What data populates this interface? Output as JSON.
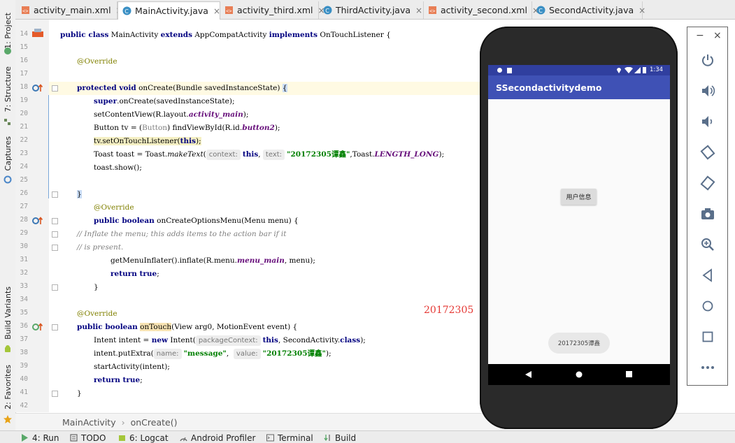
{
  "tabs": [
    {
      "label": "activity_main.xml",
      "close": "×",
      "icon": "xml-file-icon",
      "active": false
    },
    {
      "label": "MainActivity.java",
      "close": "×",
      "icon": "java-class-icon",
      "active": true
    },
    {
      "label": "activity_third.xml",
      "close": "×",
      "icon": "xml-file-icon",
      "active": false
    },
    {
      "label": "ThirdActivity.java",
      "close": "×",
      "icon": "java-class-icon",
      "active": false
    },
    {
      "label": "activity_second.xml",
      "close": "×",
      "icon": "xml-file-icon",
      "active": false
    },
    {
      "label": "SecondActivity.java",
      "close": "×",
      "icon": "java-class-icon",
      "active": false
    }
  ],
  "left_tools": [
    "1: Project",
    "7: Structure",
    "Captures",
    "Build Variants",
    "2: Favorites"
  ],
  "line_numbers": [
    "14",
    "15",
    "16",
    "17",
    "18",
    "19",
    "20",
    "21",
    "22",
    "23",
    "24",
    "25",
    "26",
    "27",
    "28",
    "29",
    "30",
    "31",
    "32",
    "33",
    "34",
    "35",
    "36",
    "37",
    "38",
    "39",
    "40",
    "41",
    "42"
  ],
  "code": {
    "l14": {
      "kw1": "public class",
      "t1": " MainActivity ",
      "kw2": "extends",
      "t2": " AppCompatActivity ",
      "kw3": "implements",
      "t3": " OnTouchListener {"
    },
    "l16": {
      "ann": "@Override"
    },
    "l18": {
      "kw": "protected void",
      "t1": " onCreate(Bundle savedInstanceState) ",
      "brace": "{"
    },
    "l19": {
      "kw": "super",
      "t": ".onCreate(savedInstanceState);"
    },
    "l20": {
      "t1": "setContentView(R.layout.",
      "fld": "activity_main",
      "t2": ");"
    },
    "l21": {
      "t1": "Button tv = (",
      "gray": "Button",
      "t2": ") findViewById(R.id.",
      "fld": "button2",
      "t3": ");"
    },
    "l22": {
      "t1": "tv.setOnTouchListener(",
      "kw": "this",
      "t2": ");"
    },
    "l23": {
      "t1": "Toast toast = Toast.",
      "it": "makeText",
      "t2": "(",
      "hint1": "context:",
      "kw": "this",
      "t3": ", ",
      "hint2": "text:",
      "str": "\"20172305谭鑫\"",
      "t4": ",Toast.",
      "fld": "LENGTH_LONG",
      "t5": ");"
    },
    "l24": {
      "t": "toast.show();"
    },
    "l26": {
      "t": "}"
    },
    "l27": {
      "ann": "@Override"
    },
    "l28": {
      "kw": "public boolean",
      "t": " onCreateOptionsMenu(Menu menu) {"
    },
    "l29": {
      "cmt": "// Inflate the menu; this adds items to the action bar if it"
    },
    "l30": {
      "cmt": "// is present."
    },
    "l31": {
      "t1": "getMenuInflater().inflate(R.menu.",
      "fld": "menu_main",
      "t2": ", menu);"
    },
    "l32": {
      "kw": "return true",
      "t": ";"
    },
    "l33": {
      "t": "}"
    },
    "l35": {
      "ann": "@Override"
    },
    "l36": {
      "kw": "public boolean",
      "t1": " ",
      "hl": "onTouch",
      "t2": "(View arg0, MotionEvent event) {"
    },
    "l37": {
      "t1": "Intent intent = ",
      "kw1": "new",
      "t2": " Intent(",
      "hint": "packageContext:",
      "kw2": "this",
      "t3": ", SecondActivity.",
      "kw3": "class",
      "t4": ");"
    },
    "l38": {
      "t1": "intent.putExtra(",
      "hint1": "name:",
      "str1": "\"message\"",
      "t2": ",  ",
      "hint2": "value:",
      "str2": "\"20172305谭鑫\"",
      "t3": ");"
    },
    "l39": {
      "t": "startActivity(intent);"
    },
    "l40": {
      "kw": "return true",
      "t": ";"
    },
    "l41": {
      "t": "}"
    }
  },
  "annotation": "20172305",
  "breadcrumb": {
    "item1": "MainActivity",
    "sep": "›",
    "item2": "onCreate()"
  },
  "bottom_tools": [
    "4: Run",
    "TODO",
    "6: Logcat",
    "Android Profiler",
    "Terminal",
    "Build"
  ],
  "phone": {
    "status_time": "1:34",
    "app_title": "SSecondactivitydemo",
    "button_label": "用户信息",
    "toast_text": "20172305谭鑫"
  },
  "emulator": {
    "minimize": "−",
    "close": "×",
    "tools": [
      "power-icon",
      "volume-up-icon",
      "volume-down-icon",
      "rotate-left-icon",
      "rotate-right-icon",
      "camera-icon",
      "zoom-icon",
      "back-icon",
      "home-icon",
      "overview-icon",
      "more-icon"
    ]
  },
  "colors": {
    "keyword": "#000080",
    "string": "#008000",
    "field": "#660e7a",
    "annotation": "#808000",
    "app_bar": "#3f51b5",
    "status_bar": "#303f9f",
    "red_note": "#e53935"
  }
}
